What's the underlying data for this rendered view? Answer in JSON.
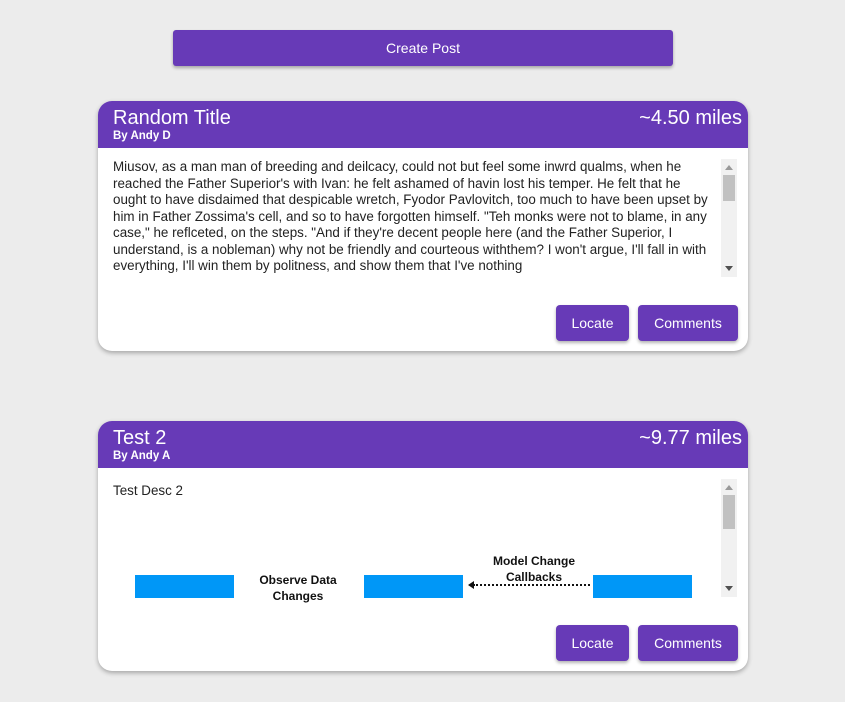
{
  "toolbar": {
    "create_post_label": "Create Post"
  },
  "posts": [
    {
      "title": "Random Title",
      "author": "By Andy D",
      "distance": "~4.50 miles",
      "description": "Miusov, as a man man of breeding and deilcacy, could not but feel some inwrd qualms, when he reached the Father Superior's with Ivan: he felt ashamed of havin lost his temper. He felt that he ought to have disdaimed that despicable wretch, Fyodor Pavlovitch, too much to have been upset by him in Father Zossima's cell, and so to have forgotten himself. \"Teh monks were not to blame, in any case,\" he reflceted, on the steps. \"And if they're decent people here (and the Father Superior, I understand, is a nobleman) why not be friendly and courteous withthem? I won't argue, I'll fall in with everything, I'll win them by politness, and show them that I've nothing",
      "locate_label": "Locate",
      "comments_label": "Comments"
    },
    {
      "title": "Test 2",
      "author": "By Andy A",
      "distance": "~9.77 miles",
      "description": "Test Desc 2",
      "locate_label": "Locate",
      "comments_label": "Comments",
      "diagram": {
        "label_observe_line1": "Observe Data",
        "label_observe_line2": "Changes",
        "label_model_line1": "Model Change",
        "label_model_line2": "Callbacks",
        "box_color": "#0097f7"
      }
    }
  ],
  "colors": {
    "accent": "#673ab7",
    "background": "#ececec"
  }
}
